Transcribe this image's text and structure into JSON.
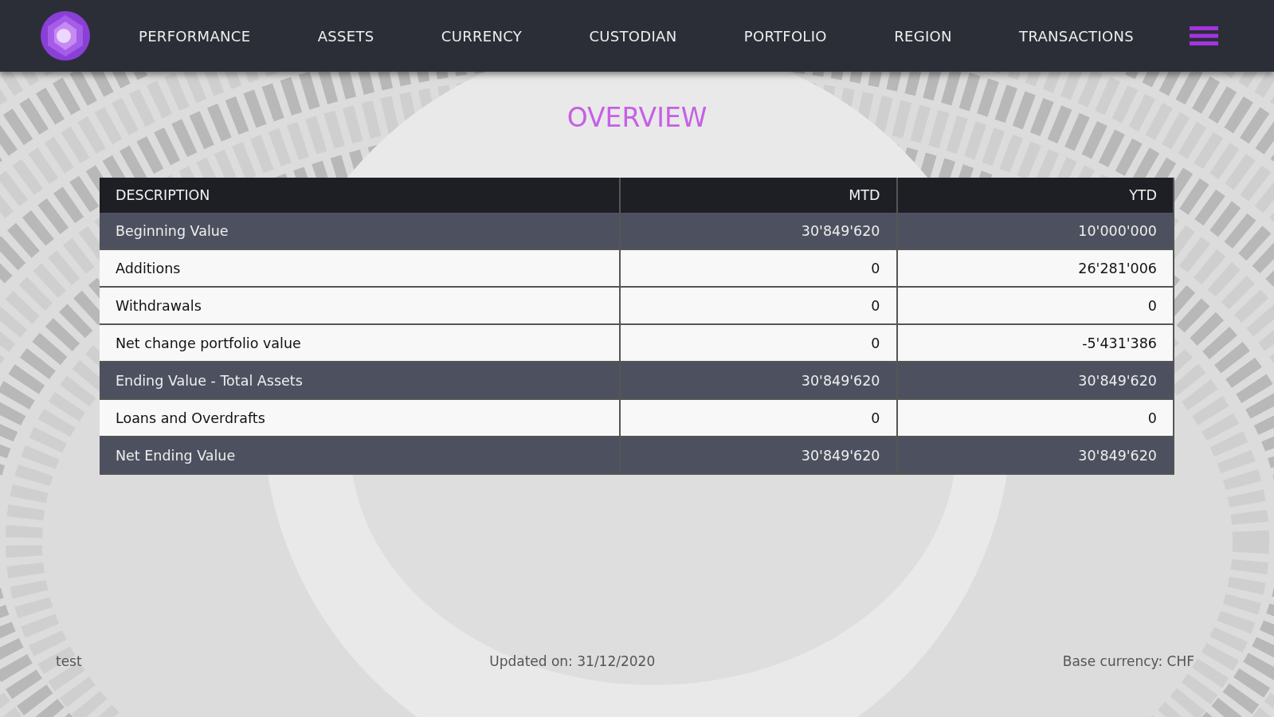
{
  "nav": {
    "items": [
      "PERFORMANCE",
      "ASSETS",
      "CURRENCY",
      "CUSTODIAN",
      "PORTFOLIO",
      "REGION",
      "TRANSACTIONS"
    ]
  },
  "title": "OVERVIEW",
  "table": {
    "columns": [
      "DESCRIPTION",
      "MTD",
      "YTD"
    ],
    "rows": [
      {
        "kind": "total",
        "cells": [
          "Beginning Value",
          "30'849'620",
          "10'000'000"
        ]
      },
      {
        "kind": "plain",
        "cells": [
          "Additions",
          "0",
          "26'281'006"
        ]
      },
      {
        "kind": "plain",
        "cells": [
          "Withdrawals",
          "0",
          "0"
        ]
      },
      {
        "kind": "plain",
        "cells": [
          "Net change portfolio value",
          "0",
          "-5'431'386"
        ]
      },
      {
        "kind": "total",
        "cells": [
          "Ending Value - Total Assets",
          "30'849'620",
          "30'849'620"
        ]
      },
      {
        "kind": "plain",
        "cells": [
          "Loans and Overdrafts",
          "0",
          "0"
        ]
      },
      {
        "kind": "total",
        "cells": [
          "Net Ending Value",
          "30'849'620",
          "30'849'620"
        ]
      }
    ]
  },
  "footer": {
    "left": "test",
    "center": "Updated on: 31/12/2020",
    "right": "Base currency: CHF"
  }
}
